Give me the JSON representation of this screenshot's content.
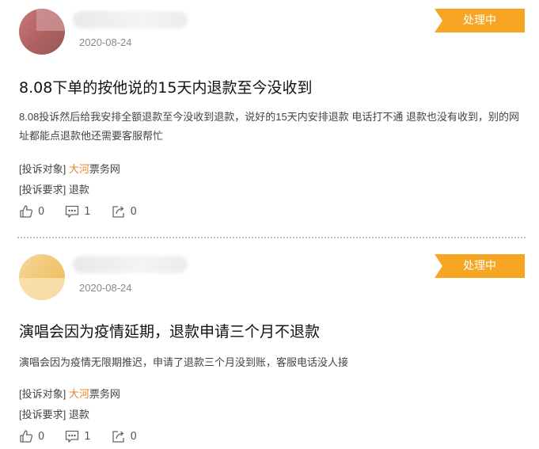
{
  "complaints": [
    {
      "date": "2020-08-24",
      "status": "处理中",
      "title": "8.08下单的按他说的15天内退款至今没收到",
      "body": "8.08投诉然后给我安排全额退款至今没收到退款，说好的15天内安排退款 电话打不通 退款也没有收到，别的网址都能点退款他还需要客服帮忙",
      "target_label": "[投诉对象]",
      "target_highlight": "大河",
      "target_rest": "票务网",
      "request_label": "[投诉要求]",
      "request_value": "退款",
      "likes": "0",
      "comments": "1",
      "shares": "0"
    },
    {
      "date": "2020-08-24",
      "status": "处理中",
      "title": "演唱会因为疫情延期，退款申请三个月不退款",
      "body": "演唱会因为疫情无限期推迟，申请了退款三个月没到账，客服电话没人接",
      "target_label": "[投诉对象]",
      "target_highlight": "大河",
      "target_rest": "票务网",
      "request_label": "[投诉要求]",
      "request_value": "退款",
      "likes": "0",
      "comments": "1",
      "shares": "0"
    }
  ],
  "icons": {
    "like": "thumbs-up-icon",
    "comment": "comment-icon",
    "share": "share-icon"
  },
  "colors": {
    "status_bg": "#f6a623",
    "highlight": "#e8842a"
  }
}
